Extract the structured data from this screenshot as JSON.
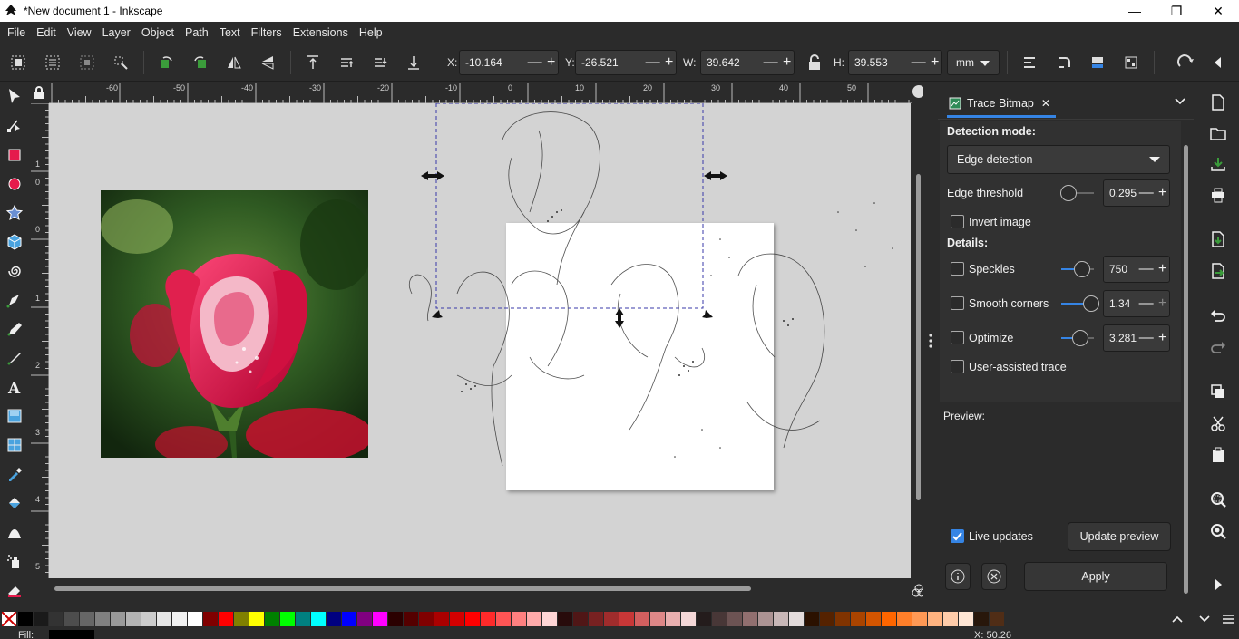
{
  "window": {
    "title": "*New document 1 - Inkscape",
    "minimize": "—",
    "restore": "❐",
    "close": "✕"
  },
  "menu": [
    "File",
    "Edit",
    "View",
    "Layer",
    "Object",
    "Path",
    "Text",
    "Filters",
    "Extensions",
    "Help"
  ],
  "toolcontrols": {
    "x_label": "X:",
    "x_value": "-10.164",
    "y_label": "Y:",
    "y_value": "-26.521",
    "w_label": "W:",
    "w_value": "39.642",
    "h_label": "H:",
    "h_value": "39.553",
    "unit": "mm",
    "minus": "—",
    "plus": "+"
  },
  "ruler": {
    "h_labels": [
      "-60",
      "-50",
      "-40",
      "-30",
      "-20",
      "-10",
      "0",
      "10",
      "20",
      "30",
      "40",
      "50"
    ],
    "v_labels": [
      "1",
      "0",
      "0",
      "1",
      "2",
      "3",
      "4",
      "5"
    ]
  },
  "panel": {
    "tab_label": "Trace Bitmap",
    "tab_close": "✕",
    "detection_mode_label": "Detection mode:",
    "detection_mode_value": "Edge detection",
    "edge_threshold_label": "Edge threshold",
    "edge_threshold_value": "0.295",
    "edge_threshold_level": 0.295,
    "invert_image_label": "Invert image",
    "invert_image_checked": false,
    "details_label": "Details:",
    "speckles_label": "Speckles",
    "speckles_checked": false,
    "speckles_value": "750",
    "smooth_corners_label": "Smooth corners",
    "smooth_corners_checked": false,
    "smooth_corners_value": "1.34",
    "optimize_label": "Optimize",
    "optimize_checked": false,
    "optimize_value": "3.281",
    "user_assisted_label": "User-assisted trace",
    "user_assisted_checked": false,
    "preview_label": "Preview:",
    "live_updates_label": "Live updates",
    "live_updates_checked": true,
    "update_preview_label": "Update preview",
    "apply_label": "Apply"
  },
  "palette": {
    "colors": [
      "#000000",
      "#1a1a1a",
      "#333333",
      "#4d4d4d",
      "#666666",
      "#808080",
      "#999999",
      "#b3b3b3",
      "#cccccc",
      "#e6e6e6",
      "#f2f2f2",
      "#ffffff",
      "#800000",
      "#ff0000",
      "#808000",
      "#ffff00",
      "#008000",
      "#00ff00",
      "#008080",
      "#00ffff",
      "#000080",
      "#0000ff",
      "#800080",
      "#ff00ff",
      "#2b0000",
      "#550000",
      "#800000",
      "#aa0000",
      "#d40000",
      "#ff0000",
      "#ff2a2a",
      "#ff5555",
      "#ff8080",
      "#ffaaaa",
      "#ffd5d5",
      "#280b0b",
      "#501616",
      "#782121",
      "#a02c2c",
      "#c83737",
      "#d35f5f",
      "#de8787",
      "#e9afaf",
      "#f4d7d7",
      "#241c1c",
      "#483737",
      "#6c5353",
      "#916f6f",
      "#ac9393",
      "#c8b7b7",
      "#e3dbdb",
      "#2b1100",
      "#552200",
      "#803300",
      "#aa4400",
      "#d45500",
      "#ff6600",
      "#ff7f2a",
      "#ff9955",
      "#ffb380",
      "#ffccaa",
      "#ffe6d5",
      "#28170b",
      "#502d16"
    ]
  },
  "status": {
    "fill_label": "Fill:",
    "x_readout": "X:    50.26"
  },
  "colors": {
    "accent": "#3584e4",
    "canvas": "#d3d3d3",
    "ui_bg": "#2b2b2b"
  }
}
